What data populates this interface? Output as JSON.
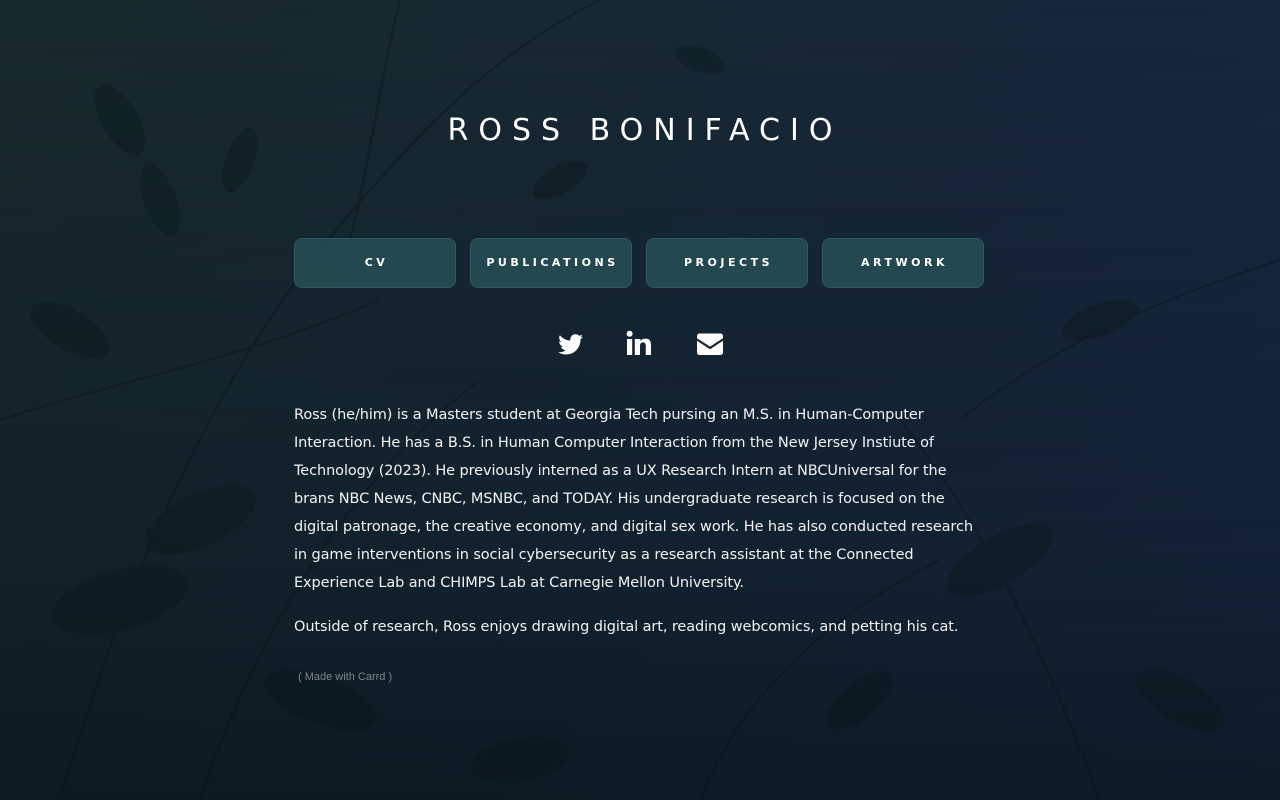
{
  "site": {
    "title": "ROSS BONIFACIO"
  },
  "nav": {
    "items": [
      {
        "label": "CV"
      },
      {
        "label": "PUBLICATIONS"
      },
      {
        "label": "PROJECTS"
      },
      {
        "label": "ARTWORK"
      }
    ]
  },
  "social": {
    "links": [
      {
        "icon": "twitter-icon"
      },
      {
        "icon": "linkedin-icon"
      },
      {
        "icon": "envelope-icon"
      }
    ]
  },
  "bio": {
    "paragraph1": "Ross (he/him) is a Masters student at Georgia Tech pursing an M.S. in Human-Computer Interaction. He has a B.S. in Human Computer Interaction from the New Jersey Instiute of Technology (2023). He previously interned as a UX Research Intern at NBCUniversal for the brans NBC News, CNBC, MSNBC, and TODAY. His undergraduate research is focused on the digital patronage, the creative economy, and digital sex work. He has also conducted research in game interventions in social cybersecurity as a research assistant at the Connected Experience Lab and CHIMPS Lab at Carnegie Mellon University.",
    "paragraph2": "Outside of research, Ross enjoys drawing digital art, reading webcomics, and petting his cat."
  },
  "footer": {
    "credit": "( Made with Carrd )"
  },
  "colors": {
    "button_bg": "#29565c",
    "text": "#ffffff",
    "background": "#16273a"
  }
}
